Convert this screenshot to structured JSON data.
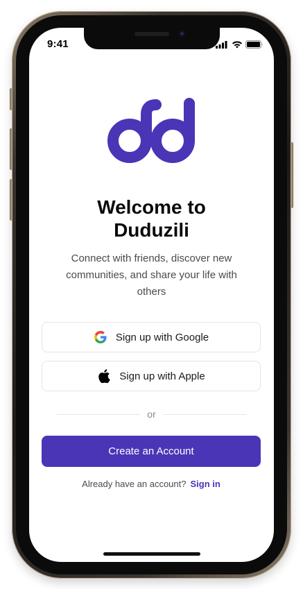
{
  "status_bar": {
    "time": "9:41",
    "icons": [
      "cellular-signal-icon",
      "wifi-icon",
      "battery-icon"
    ]
  },
  "app": {
    "logo_icon": "duduzili-logo-icon",
    "brand_color": "#4a35b6"
  },
  "welcome": {
    "title_line1": "Welcome to",
    "title_line2": "Duduzili",
    "subtitle": "Connect with friends, discover new communities, and share your life with others"
  },
  "auth": {
    "google_label": "Sign up with Google",
    "google_icon": "google-icon",
    "apple_label": "Sign up with Apple",
    "apple_icon": "apple-icon",
    "divider_text": "or",
    "create_account_label": "Create an Account",
    "signin_prompt": "Already have an account?",
    "signin_link": "Sign in"
  }
}
